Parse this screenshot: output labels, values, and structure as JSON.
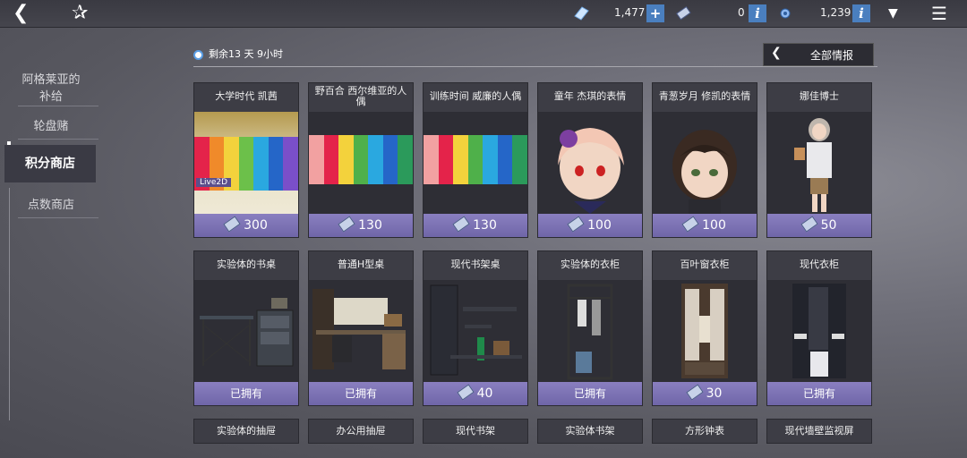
{
  "top": {
    "currency1": "1,477",
    "currency2": "0",
    "currency3": "1,239"
  },
  "sidebar": {
    "items": [
      "阿格莱亚的\n补给",
      "轮盘赌",
      "积分商店",
      "点数商店"
    ]
  },
  "header": {
    "timer": "剩余13 天 9小时",
    "info_tab": "全部情报"
  },
  "row1": [
    {
      "title": "大学时代 凯茜",
      "price": "300",
      "badge": "Live2D"
    },
    {
      "title": "野百合 西尔维亚的人偶",
      "price": "130"
    },
    {
      "title": "训练时间 威廉的人偶",
      "price": "130"
    },
    {
      "title": "童年 杰琪的表情",
      "price": "100"
    },
    {
      "title": "青葱岁月 修凯的表情",
      "price": "100"
    },
    {
      "title": "娜佳博士",
      "price": "50"
    }
  ],
  "row2": [
    {
      "title": "实验体的书桌",
      "price": "已拥有"
    },
    {
      "title": "普通H型桌",
      "price": "已拥有"
    },
    {
      "title": "现代书架桌",
      "price": "40"
    },
    {
      "title": "实验体的衣柜",
      "price": "已拥有"
    },
    {
      "title": "百叶窗衣柜",
      "price": "30"
    },
    {
      "title": "现代衣柜",
      "price": "已拥有"
    }
  ],
  "row3": [
    "实验体的抽屉",
    "办公用抽屉",
    "现代书架",
    "实验体书架",
    "方形钟表",
    "现代墙壁监视屏"
  ],
  "colors": {
    "accent": "#7b70b8",
    "info": "#4a7fbf"
  }
}
